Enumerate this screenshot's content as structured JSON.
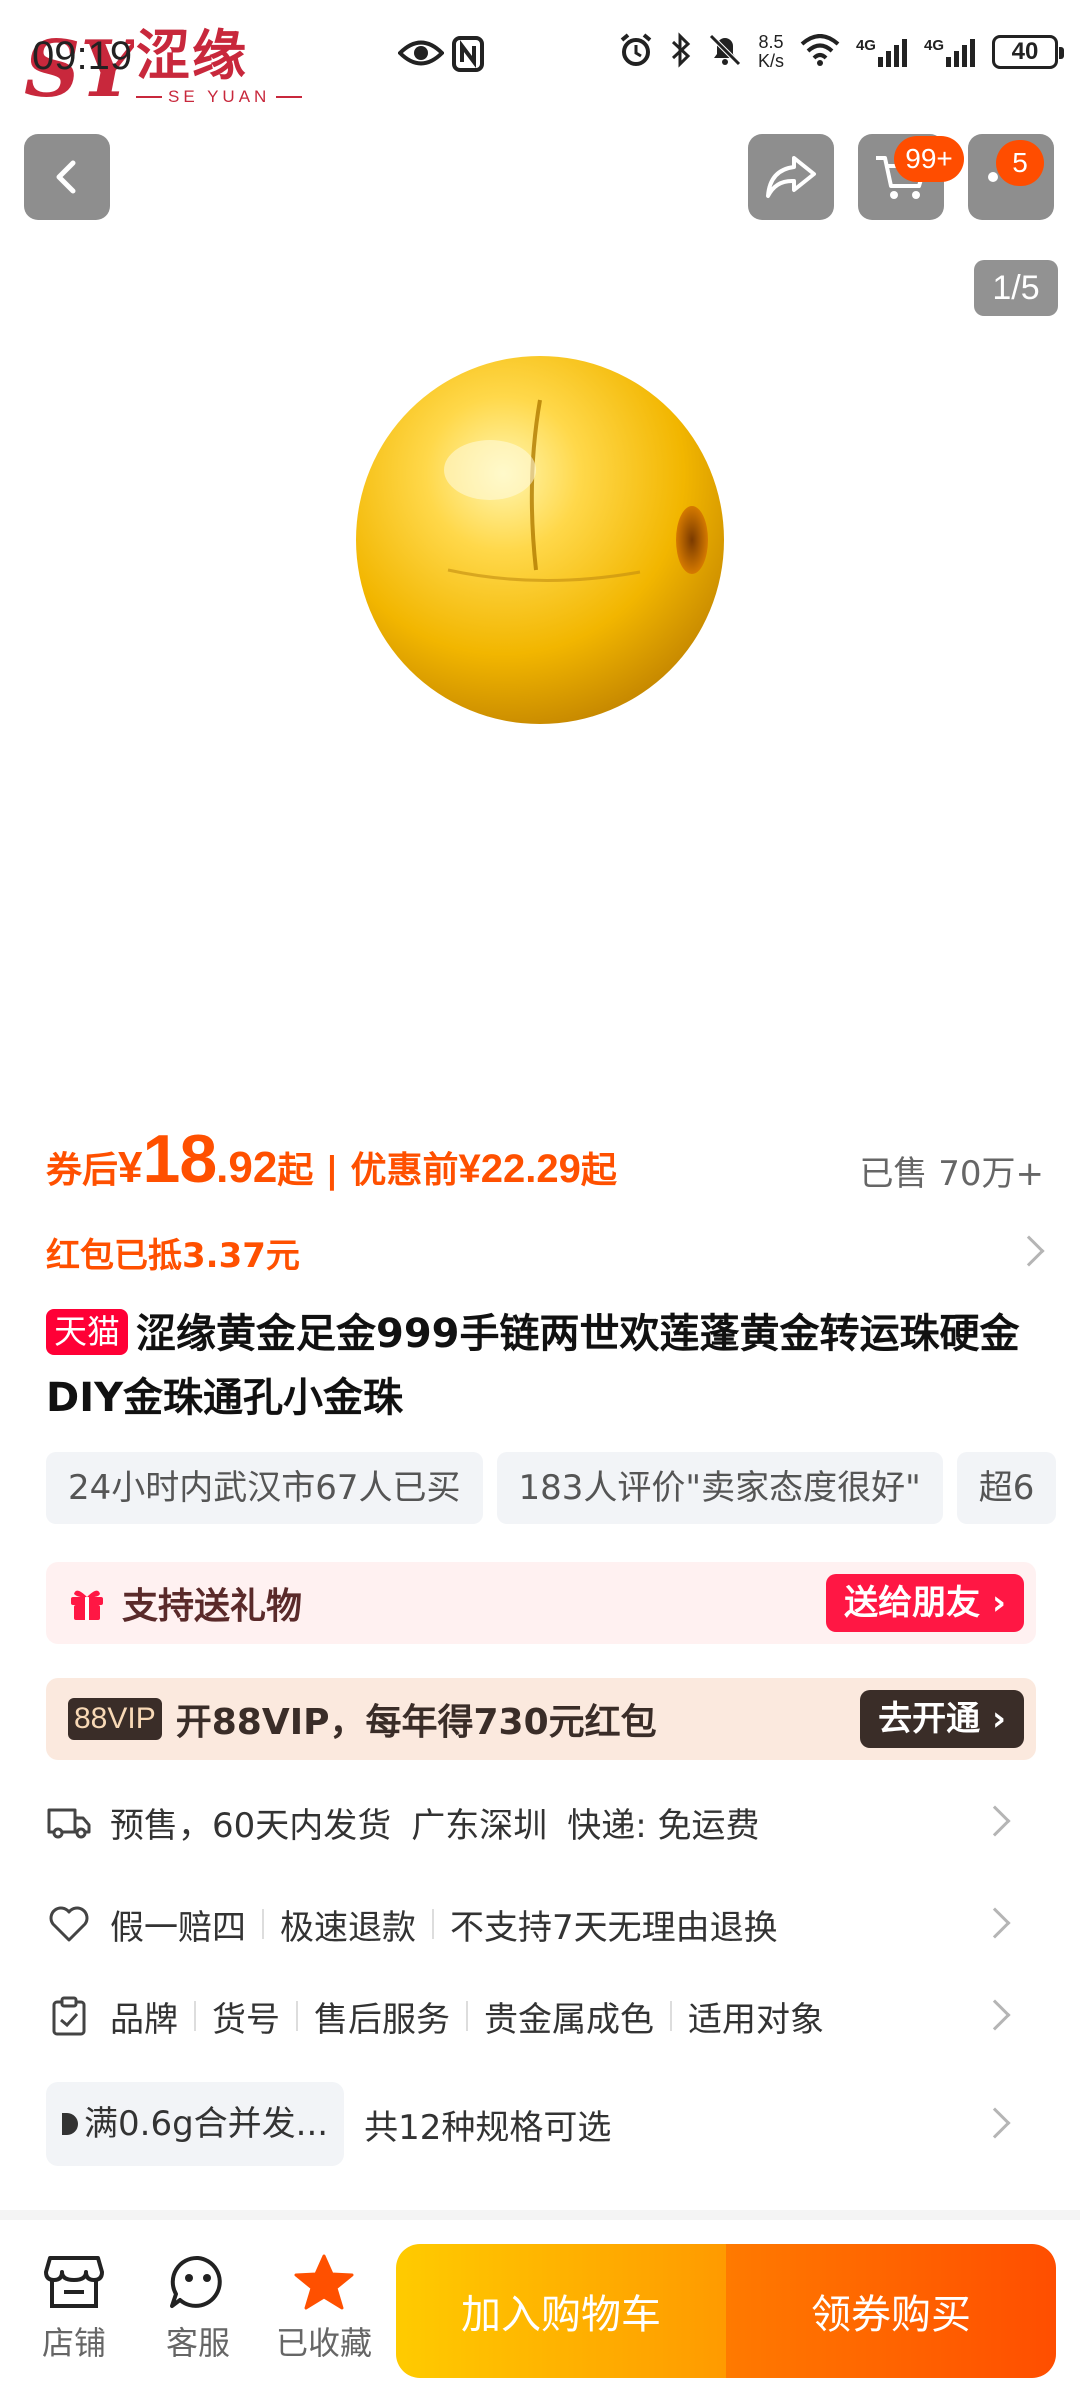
{
  "status_bar": {
    "time": "09:19",
    "speed_value": "8.5",
    "speed_unit": "K/s",
    "net1": "4G",
    "net2": "4G",
    "battery": "40"
  },
  "brand": {
    "name_cn": "涩缘",
    "name_en": "SE YUAN"
  },
  "nav": {
    "cart_badge": "99+",
    "more_badge": "5",
    "image_counter": "1/5"
  },
  "price": {
    "after_coupon_label": "券后",
    "currency": "¥",
    "after_coupon_int": "18",
    "after_coupon_dec": ".92",
    "suffix": "起",
    "separator": "|",
    "before_label": "优惠前",
    "before_value": "¥22.29",
    "before_suffix": "起",
    "sold": "已售 70万+",
    "coupon_note": "红包已抵3.37元"
  },
  "product": {
    "store_tag": "天猫",
    "title": "涩缘黄金足金999手链两世欢莲蓬黄金转运珠硬金DIY金珠通孔小金珠"
  },
  "tags": [
    "24小时内武汉市67人已买",
    "183人评价\"卖家态度很好\"",
    "超6"
  ],
  "gift": {
    "label": "支持送礼物",
    "button": "送给朋友"
  },
  "vip": {
    "tag": "88VIP",
    "text": "开88VIP，每年得730元红包",
    "button": "去开通"
  },
  "shipping": [
    "预售，60天内发货",
    "广东深圳",
    "快递: 免运费"
  ],
  "guarantee": [
    "假一赔四",
    "极速退款",
    "不支持7天无理由退换"
  ],
  "params": [
    "品牌",
    "货号",
    "售后服务",
    "贵金属成色",
    "适用对象"
  ],
  "spec": {
    "chip": "满0.6g合并发...",
    "text": "共12种规格可选"
  },
  "bottom": {
    "shop": "店铺",
    "service": "客服",
    "favorite": "已收藏",
    "add_cart": "加入购物车",
    "buy": "领券购买"
  },
  "colors": {
    "accent": "#ff5000",
    "tmall": "#ff0036",
    "favorite": "#ff5000"
  }
}
